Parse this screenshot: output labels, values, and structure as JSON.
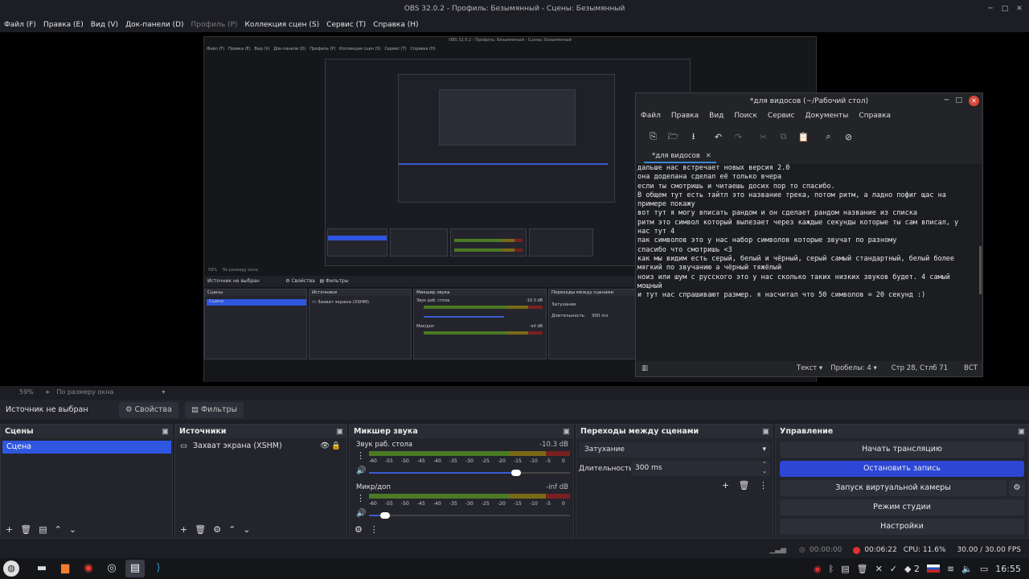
{
  "window": {
    "title": "OBS 32.0.2 - Профиль: Безымянный - Сцены: Безымянный"
  },
  "menu": [
    "Файл (F)",
    "Правка (E)",
    "Вид (V)",
    "Док-панели (D)",
    "Профиль (P)",
    "Коллекция сцен (S)",
    "Сервис (T)",
    "Справка (H)"
  ],
  "nested_obs": {
    "title": "OBS 32.0.2 - Профиль: Безымянный - Сцены: Безымянный",
    "zoom": "59%",
    "fit": "По размеру окна",
    "source_none": "Источник не выбран",
    "props": "Свойства",
    "filters": "Фильтры",
    "scenes": "Сцены",
    "scene": "Сцена",
    "sources": "Источники",
    "capture": "Захват экрана (XSHM)",
    "mixer": "Микшер звука",
    "desktop": "Звук раб. стола",
    "mic": "Мик/доп",
    "transitions": "Переходы между сценами",
    "fade": "Затухание",
    "dur": "Длительность",
    "ms": "300 ms",
    "db1": "-10.3 dB",
    "db2": "-inf dB"
  },
  "editor": {
    "title": "*для видосов (~/Рабочий стол)",
    "menu": [
      "Файл",
      "Правка",
      "Вид",
      "Поиск",
      "Сервис",
      "Документы",
      "Справка"
    ],
    "tab": "*для видосов",
    "lines": [
      "дальше нас встречает новых версия 2.0",
      "она доделана сделал её только вчера",
      "",
      "если ты смотришь и читаешь досих пор то спасибо.",
      "",
      "В общем тут есть тайтл это название трека, потом ритм, а ладно пофиг щас на",
      "примере покажу",
      "",
      "вот тут я могу вписать рандом и он сделает рандом название из списка",
      "ритм это символ который вылезает через каждые секунды которые ты сам вписал, у",
      "нас тут 4",
      "пак символов это у нас набор символов которые звучат по разному",
      "",
      "спасибо что смотришь <3",
      "",
      "как мы видим есть серый, белый и чёрный, серый самый стандартный, белый более",
      "мягкий по звучанию а чёрный тяжёлый",
      "",
      "ноиз или шум с русского это у нас сколько таких низких звуков будет. 4 самый",
      "мощный",
      "",
      "и тут нас спрашивают размер. я насчитал что 50 символов = 20 секунд :)"
    ],
    "status_text": "Текст",
    "status_spaces": "Пробелы: 4",
    "status_pos": "Стр 28, Стлб 71",
    "status_ins": "ВСТ"
  },
  "zoom": {
    "percent": "59%",
    "fit": "По размеру окна"
  },
  "source_bar": {
    "none": "Источник не выбран",
    "props": "Свойства",
    "filters": "Фильтры"
  },
  "scenes": {
    "title": "Сцены",
    "items": [
      "Сцена"
    ]
  },
  "sources": {
    "title": "Источники",
    "items": [
      "Захват экрана (XSHM)"
    ]
  },
  "mixer": {
    "title": "Микшер звука",
    "ch1": "Звук раб. стола",
    "ch1_db": "-10.3 dB",
    "ch2": "Микр/доп",
    "ch2_db": "-inf dB",
    "ticks": [
      "-60",
      "-55",
      "-50",
      "-45",
      "-40",
      "-35",
      "-30",
      "-25",
      "-20",
      "-15",
      "-10",
      "-5",
      "0"
    ],
    "ch1_volume": 0.73,
    "ch2_volume": 0.08
  },
  "transitions": {
    "title": "Переходы между сценами",
    "selected": "Затухание",
    "duration_label": "Длительность",
    "duration": "300 ms"
  },
  "controls": {
    "title": "Управление",
    "start_stream": "Начать трансляцию",
    "stop_record": "Остановить запись",
    "virtual_cam": "Запуск виртуальной камеры",
    "studio": "Режим студии",
    "settings": "Настройки"
  },
  "status": {
    "stream_time": "00:00:00",
    "rec_time": "00:06:22",
    "cpu": "CPU: 11.6%",
    "fps": "30.00 / 30.00 FPS"
  },
  "taskbar": {
    "time": "16:55",
    "workspace": "2"
  },
  "colors": {
    "accent": "#2c46d6",
    "scene_sel": "#2f56e0",
    "rec": "#e03030"
  }
}
